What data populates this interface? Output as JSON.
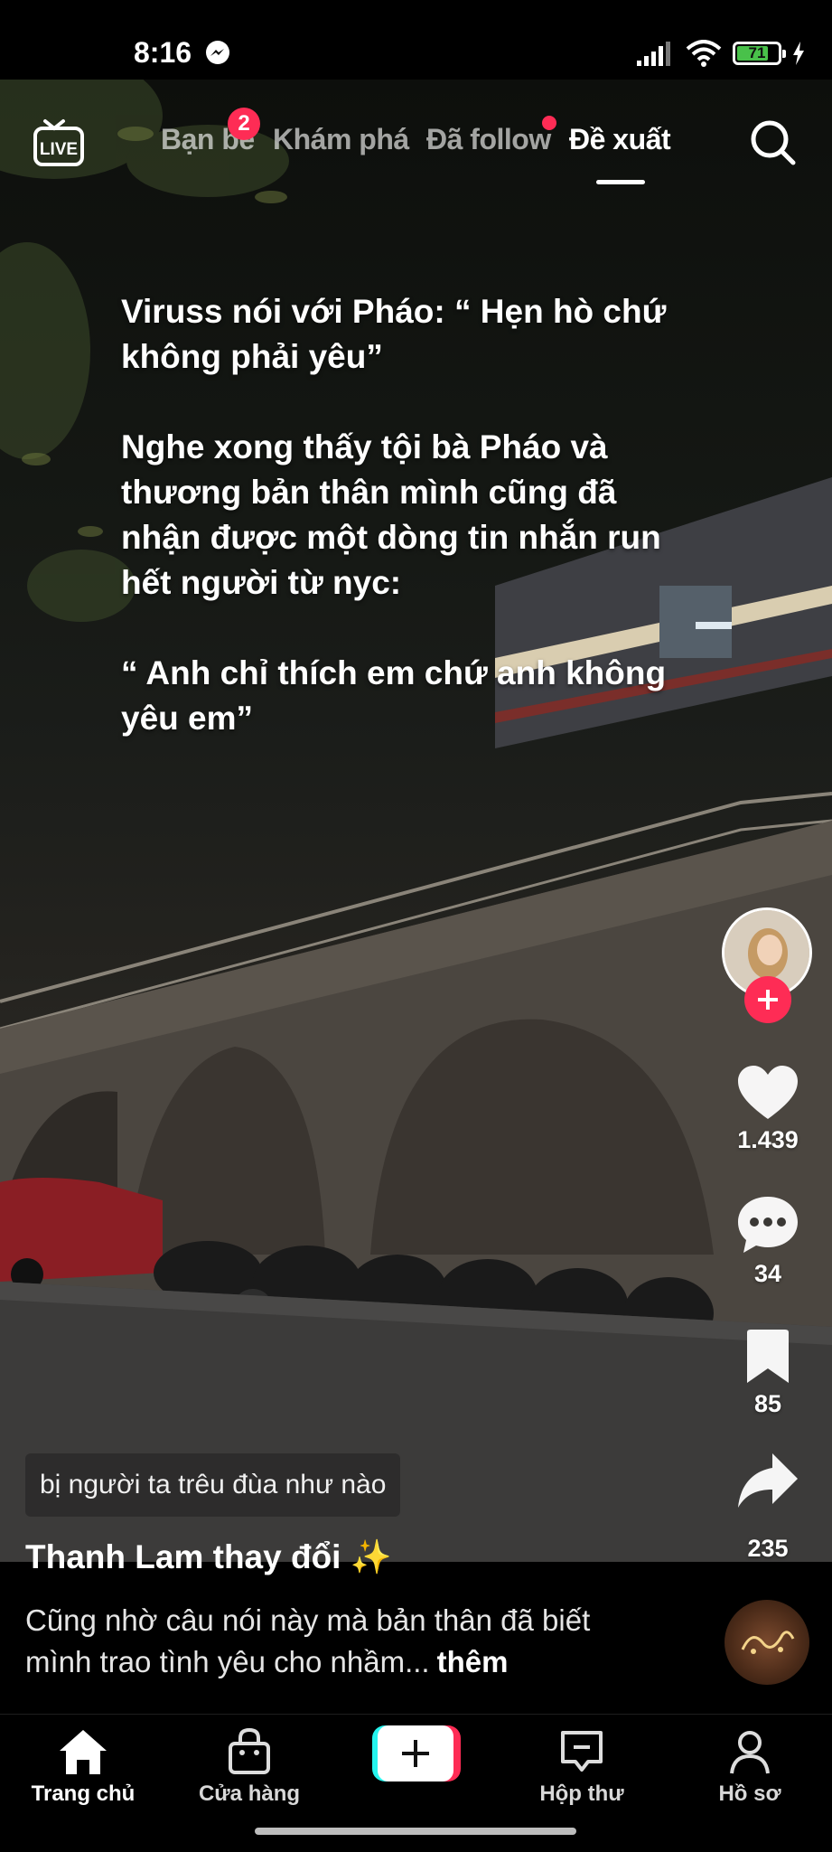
{
  "status_bar": {
    "time": "8:16",
    "battery": "71"
  },
  "top_nav": {
    "live_label": "LIVE",
    "tabs": [
      {
        "label": "Bạn bè",
        "badge": "2"
      },
      {
        "label": "Khám phá"
      },
      {
        "label": "Đã follow"
      },
      {
        "label": "Đề xuất"
      }
    ]
  },
  "overlay": {
    "paragraphs": [
      "Viruss nói với Pháo: “ Hẹn hò chứ không phải yêu”",
      "Nghe xong thấy tội bà Pháo và thương bản thân mình cũng đã nhận được một dòng tin nhắn run hết người từ nyc:",
      "“ Anh chỉ thích em chứ anh không yêu em”"
    ]
  },
  "actions": {
    "likes": "1.439",
    "comments": "34",
    "saves": "85",
    "shares": "235"
  },
  "caption": {
    "search_tag": "bị người ta trêu đùa như nào",
    "author": "Thanh Lam thay đổi ✨",
    "description": "Cũng nhờ câu nói này mà bản thân đã biết mình trao tình yêu cho nhầm...",
    "more": "thêm"
  },
  "bottom_nav": {
    "items": [
      "Trang chủ",
      "Cửa hàng",
      "Hộp thư",
      "Hồ sơ"
    ]
  },
  "colors": {
    "accent": "#fe2c55",
    "cyan": "#25f4ee",
    "battery_green": "#49c14a"
  }
}
